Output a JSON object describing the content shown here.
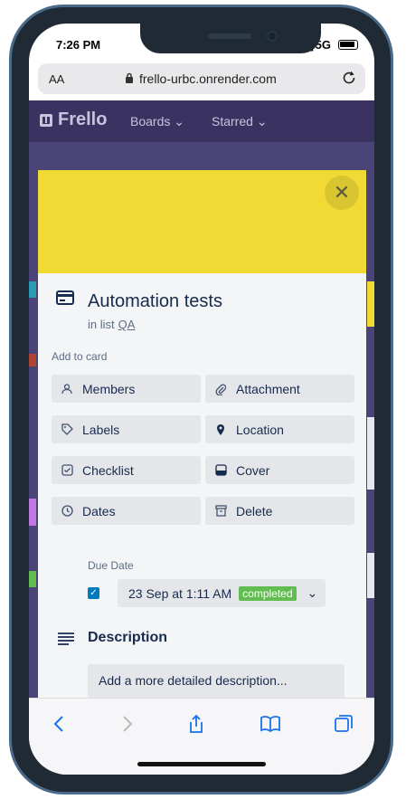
{
  "status": {
    "time": "7:26 PM",
    "network": "5G"
  },
  "browser": {
    "text_size": "AA",
    "url": "frello-urbc.onrender.com"
  },
  "app": {
    "logo": "Frello",
    "nav_boards": "Boards",
    "nav_starred": "Starred"
  },
  "card": {
    "title": "Automation tests",
    "in_list_prefix": "in list",
    "list_name": "QA",
    "add_to_card": "Add to card",
    "actions": {
      "members": "Members",
      "attachment": "Attachment",
      "labels": "Labels",
      "location": "Location",
      "checklist": "Checklist",
      "cover": "Cover",
      "dates": "Dates",
      "delete": "Delete"
    },
    "due_date_label": "Due Date",
    "due_date_value": "23 Sep at 1:11 AM",
    "due_status": "completed",
    "description_heading": "Description",
    "description_placeholder": "Add a more detailed description..."
  },
  "colors": {
    "cover": "#f0da33",
    "board_bg": "#4b4478",
    "badge": "#61bd4f",
    "checkbox": "#0079bf"
  }
}
